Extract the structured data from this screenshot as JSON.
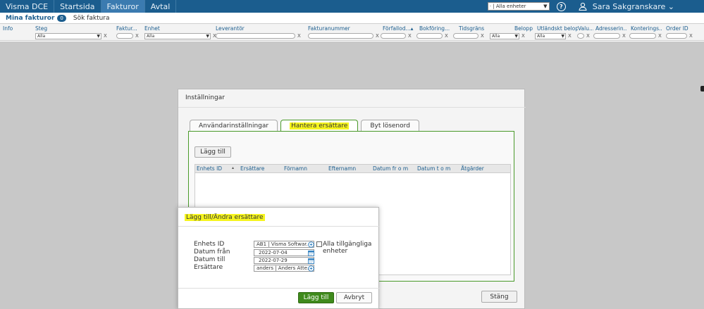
{
  "topnav": {
    "tabs": [
      "Visma DCE",
      "Startsida",
      "Fakturor",
      "Avtal"
    ],
    "active": 2,
    "unit_select": "· | Alla enheter",
    "user_name": "Sara Sakgranskare ⌄"
  },
  "subnav": {
    "mine_label": "Mina fakturor",
    "mine_count": "0",
    "search_label": "Sök faktura"
  },
  "columns": [
    "Info",
    "Steg",
    "Faktur...",
    "Enhet",
    "Leverantör",
    "Fakturanummer",
    "Förfallod...▴",
    "Bokföring...",
    "Tidsgräns",
    "Belopp",
    "Utländskt belopp",
    "Valu...",
    "Adresserin...",
    "Konterings...",
    "Order ID"
  ],
  "filters": {
    "steg_value": "Alla",
    "enhet_value": "Alla",
    "belopp_value": "Alla",
    "utl_value": "Alla",
    "clear": "X"
  },
  "settings_dialog": {
    "title": "Inställningar",
    "tabs": [
      "Användarinställningar",
      "Hantera ersättare",
      "Byt lösenord"
    ],
    "selected_tab": 1,
    "add_button": "Lägg till",
    "grid_columns": [
      "Enhets ID",
      "Ersättare",
      "Förnamn",
      "Efternamn",
      "Datum fr o m",
      "Datum t o m",
      "Åtgärder"
    ],
    "sort_indicator": "▴",
    "close_button": "Stäng"
  },
  "add_dialog": {
    "title": "Lägg till/Ändra ersättare",
    "fields": {
      "unit_label": "Enhets ID",
      "unit_value": "AB1 | Visma Softwar...",
      "all_units_label": "Alla tillgängliga enheter",
      "from_label": "Datum från",
      "from_value": "2022-07-04",
      "to_label": "Datum till",
      "to_value": "2022-07-29",
      "substitute_label": "Ersättare",
      "substitute_value": "anders | Anders Atte..."
    },
    "add_button": "Lägg till",
    "cancel_button": "Avbryt"
  },
  "colors": {
    "nav_blue": "#1b5d8e",
    "accent_green": "#3f8a1c",
    "highlight_yellow": "#f6f51e"
  }
}
